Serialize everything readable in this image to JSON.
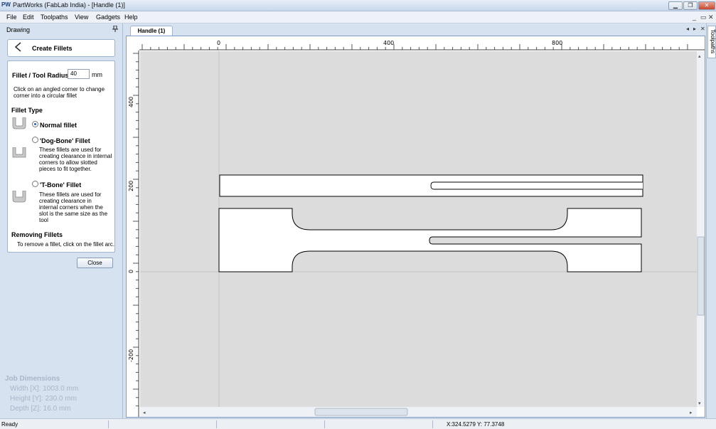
{
  "window": {
    "app_icon": "PW",
    "title": "PartWorks (FabLab India) - [Handle (1)]",
    "controls": {
      "minimize": "▁",
      "maximize": "❐",
      "close": "✕"
    }
  },
  "menu": {
    "items": [
      "File",
      "Edit",
      "Toolpaths",
      "View",
      "Gadgets",
      "Help"
    ],
    "mdi_controls": [
      "_",
      "▭",
      "✕"
    ]
  },
  "left_panel": {
    "header": "Drawing",
    "pin_icon": "pin-icon",
    "title": "Create Fillets",
    "radius_label": "Fillet / Tool Radius:",
    "radius_value": "40",
    "radius_unit": "mm",
    "instruction_line1": "Click on an angled corner to change",
    "instruction_line2": "corner into a circular fillet",
    "fillet_type_heading": "Fillet Type",
    "normal_fillet": {
      "label": "Normal fillet",
      "checked": true
    },
    "dogbone_fillet": {
      "label": "'Dog-Bone' Fillet",
      "desc": [
        "These fillets are used for",
        "creating clearance in internal",
        "corners to allow slotted",
        "pieces to fit together."
      ],
      "checked": false
    },
    "tbone_fillet": {
      "label": "'T-Bone' Fillet",
      "desc": [
        "These fillets are used for",
        "creating clearance in",
        "internal corners when the",
        "slot is the same size as the",
        "tool"
      ],
      "checked": false
    },
    "removing_heading": "Removing Fillets",
    "removing_text": "To remove a fillet, click on the fillet arc.",
    "close_button": "Close"
  },
  "job_dimensions": {
    "heading": "Job Dimensions",
    "width": "Width  [X]: 1003.0 mm",
    "height": "Height [Y]: 230.0 mm",
    "depth": "Depth  [Z]: 16.0 mm"
  },
  "tabs": {
    "active": "Handle (1)",
    "nav_left": "◂",
    "nav_right": "▸",
    "nav_close": "✕"
  },
  "rulers": {
    "horizontal_labels": [
      "0",
      "400",
      "800"
    ],
    "vertical_labels": [
      "400",
      "200",
      "0",
      "-200"
    ]
  },
  "right_dock": {
    "tab_label": "Toolpaths"
  },
  "status": {
    "text": "Ready",
    "coords": "X:324.5279 Y: 77.3748"
  },
  "colors": {
    "canvas_bg": "#dcdcdc",
    "panel_bg": "#d6e2f0",
    "border_blue": "#7f9dc4"
  }
}
